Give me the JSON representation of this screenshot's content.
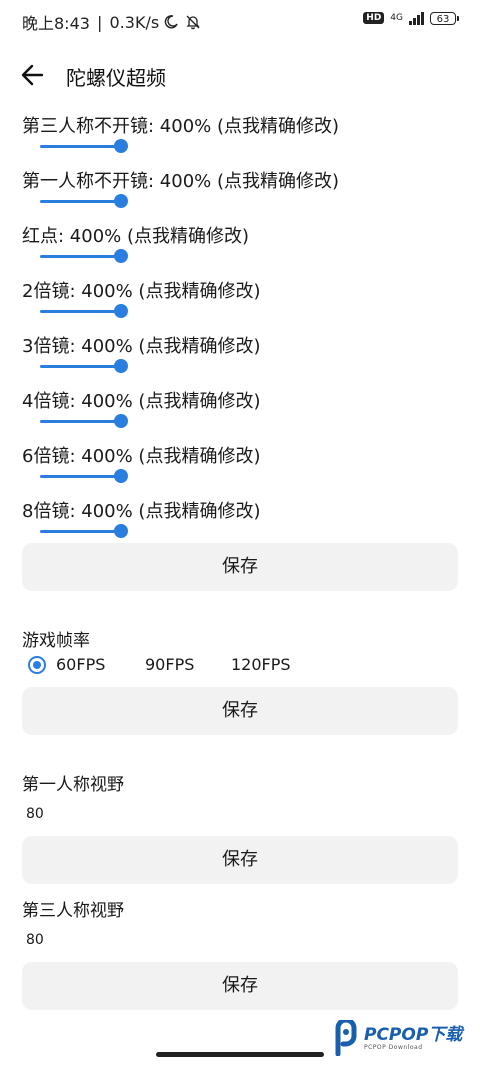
{
  "status": {
    "time": "晚上8:43",
    "separator": " | ",
    "speed": "0.3K/s",
    "hd": "HD",
    "network": "4G",
    "battery": "63"
  },
  "header": {
    "title": "陀螺仪超频"
  },
  "sliders": [
    {
      "label": "第三人称不开镜: 400% (点我精确修改)",
      "value": 400
    },
    {
      "label": "第一人称不开镜: 400% (点我精确修改)",
      "value": 400
    },
    {
      "label": "红点: 400% (点我精确修改)",
      "value": 400
    },
    {
      "label": "2倍镜: 400% (点我精确修改)",
      "value": 400
    },
    {
      "label": "3倍镜: 400% (点我精确修改)",
      "value": 400
    },
    {
      "label": "4倍镜: 400% (点我精确修改)",
      "value": 400
    },
    {
      "label": "6倍镜: 400% (点我精确修改)",
      "value": 400
    },
    {
      "label": "8倍镜: 400% (点我精确修改)",
      "value": 400
    }
  ],
  "save_label": "保存",
  "fps": {
    "title": "游戏帧率",
    "options": [
      "60FPS",
      "90FPS",
      "120FPS"
    ],
    "selected": "60FPS"
  },
  "fov_first": {
    "title": "第一人称视野",
    "value": "80"
  },
  "fov_third": {
    "title": "第三人称视野",
    "value": "80"
  },
  "watermark": {
    "text": "PCPOP下载",
    "sub": "PCPOP Download"
  },
  "colors": {
    "accent": "#2a7ee0",
    "button_bg": "#f2f2f2",
    "watermark": "#1a5fae"
  }
}
